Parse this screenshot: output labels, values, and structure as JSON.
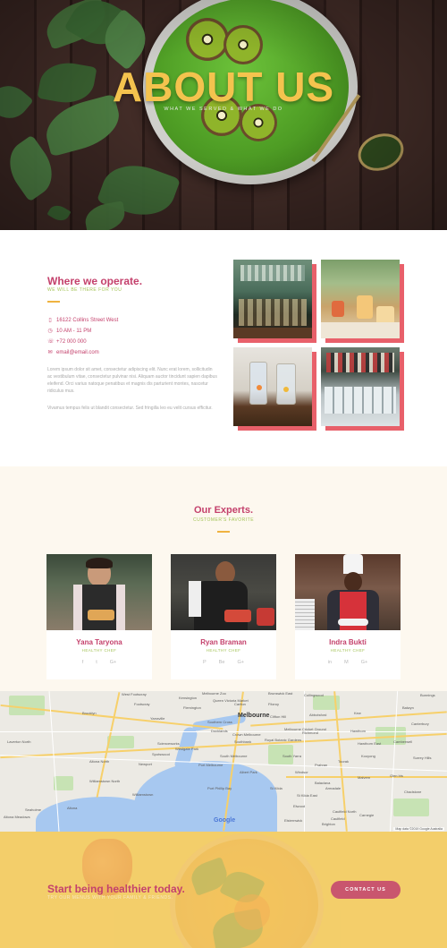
{
  "hero": {
    "title": "ABOUT US",
    "subtitle": "WHAT WE SERVED & WHAT WE DO"
  },
  "where": {
    "title": "Where we operate.",
    "subtitle": "WE WILL BE THERE FOR YOU",
    "address": "16122 Collins Street West",
    "hours": "10 AM - 11 PM",
    "phone": "+72 000 000",
    "email": "email@email.com",
    "paragraph1": "Lorem ipsum dolor sit amet, consectetur adipiscing elit. Nunc erat lorem, sollicitudin ac vestibulum vitae, consectetur pulvinar nisi. Aliquam auctor tincidunt sapien dapibus eleifend. Orci varius natoque penatibus et magnis dis parturient montes, nascetur ridiculus mus.",
    "paragraph2": "Vivamus tempus felis ut blandit consectetur. Sed fringilla leo eu velit cursus efficitur."
  },
  "experts": {
    "title": "Our Experts.",
    "subtitle": "CUSTOMER'S FAVORITE",
    "members": [
      {
        "name": "Yana Taryona",
        "role": "HEALTHY CHEF",
        "social": [
          "f",
          "t",
          "G+"
        ]
      },
      {
        "name": "Ryan Braman",
        "role": "HEALTHY CHEF",
        "social": [
          "P",
          "Be",
          "G+"
        ]
      },
      {
        "name": "Indra Bukti",
        "role": "HEALTHY CHEF",
        "social": [
          "in",
          "M",
          "G+"
        ]
      }
    ]
  },
  "map": {
    "city": "Melbourne",
    "labels": [
      "West Footscray",
      "Brooklyn",
      "Yarraville",
      "Footscray",
      "Kensington",
      "Flemington",
      "Laverton North",
      "Altona North",
      "Newport",
      "Spotswood",
      "Williamstown North",
      "Williamstown",
      "Altona",
      "Altona Meadows",
      "Seaholme",
      "Port Phillip Bay",
      "Docklands",
      "Southbank",
      "South Melbourne",
      "Port Melbourne",
      "Albert Park",
      "St Kilda",
      "St Kilda East",
      "Elwood",
      "Brighton",
      "Balaclava",
      "Caulfield North",
      "Windsor",
      "Prahran",
      "Toorak",
      "South Yarra",
      "Richmond",
      "Hawthorn",
      "Hawthorn East",
      "Camberwell",
      "Kooyong",
      "Malvern",
      "Armadale",
      "Glen Iris",
      "Collingwood",
      "Fitzroy",
      "Carlton",
      "Abbotsford",
      "Kew",
      "Balwyn",
      "Canterbury",
      "Surrey Hills",
      "Chadstone",
      "Carnegie",
      "Caulfield",
      "Elsternwick",
      "Brunswick East",
      "Clifton Hill",
      "Royal Botanic Gardens",
      "Melbourne Cricket Ground",
      "Crown Melbourne",
      "Queen Victoria Market",
      "Southern Cross",
      "Scienceworks",
      "Westgate Park",
      "Melbourne Zoo",
      "Bunnings"
    ],
    "google": "Google",
    "footer": "Map data ©2019 Google   Australia"
  },
  "cta": {
    "title": "Start being healthier today.",
    "subtitle": "TRY OUR MENUS WITH YOUR FAMILY & FRIENDS.",
    "button": "CONTACT US"
  },
  "colors": {
    "accent": "#c4416c",
    "green": "#a5c45a",
    "gold": "#f4c34e",
    "button": "#c9566e",
    "photo_shadow": "#e8606a"
  },
  "icons": {
    "address": "phone-book-icon",
    "hours": "clock-icon",
    "phone": "phone-icon",
    "email": "envelope-icon"
  }
}
